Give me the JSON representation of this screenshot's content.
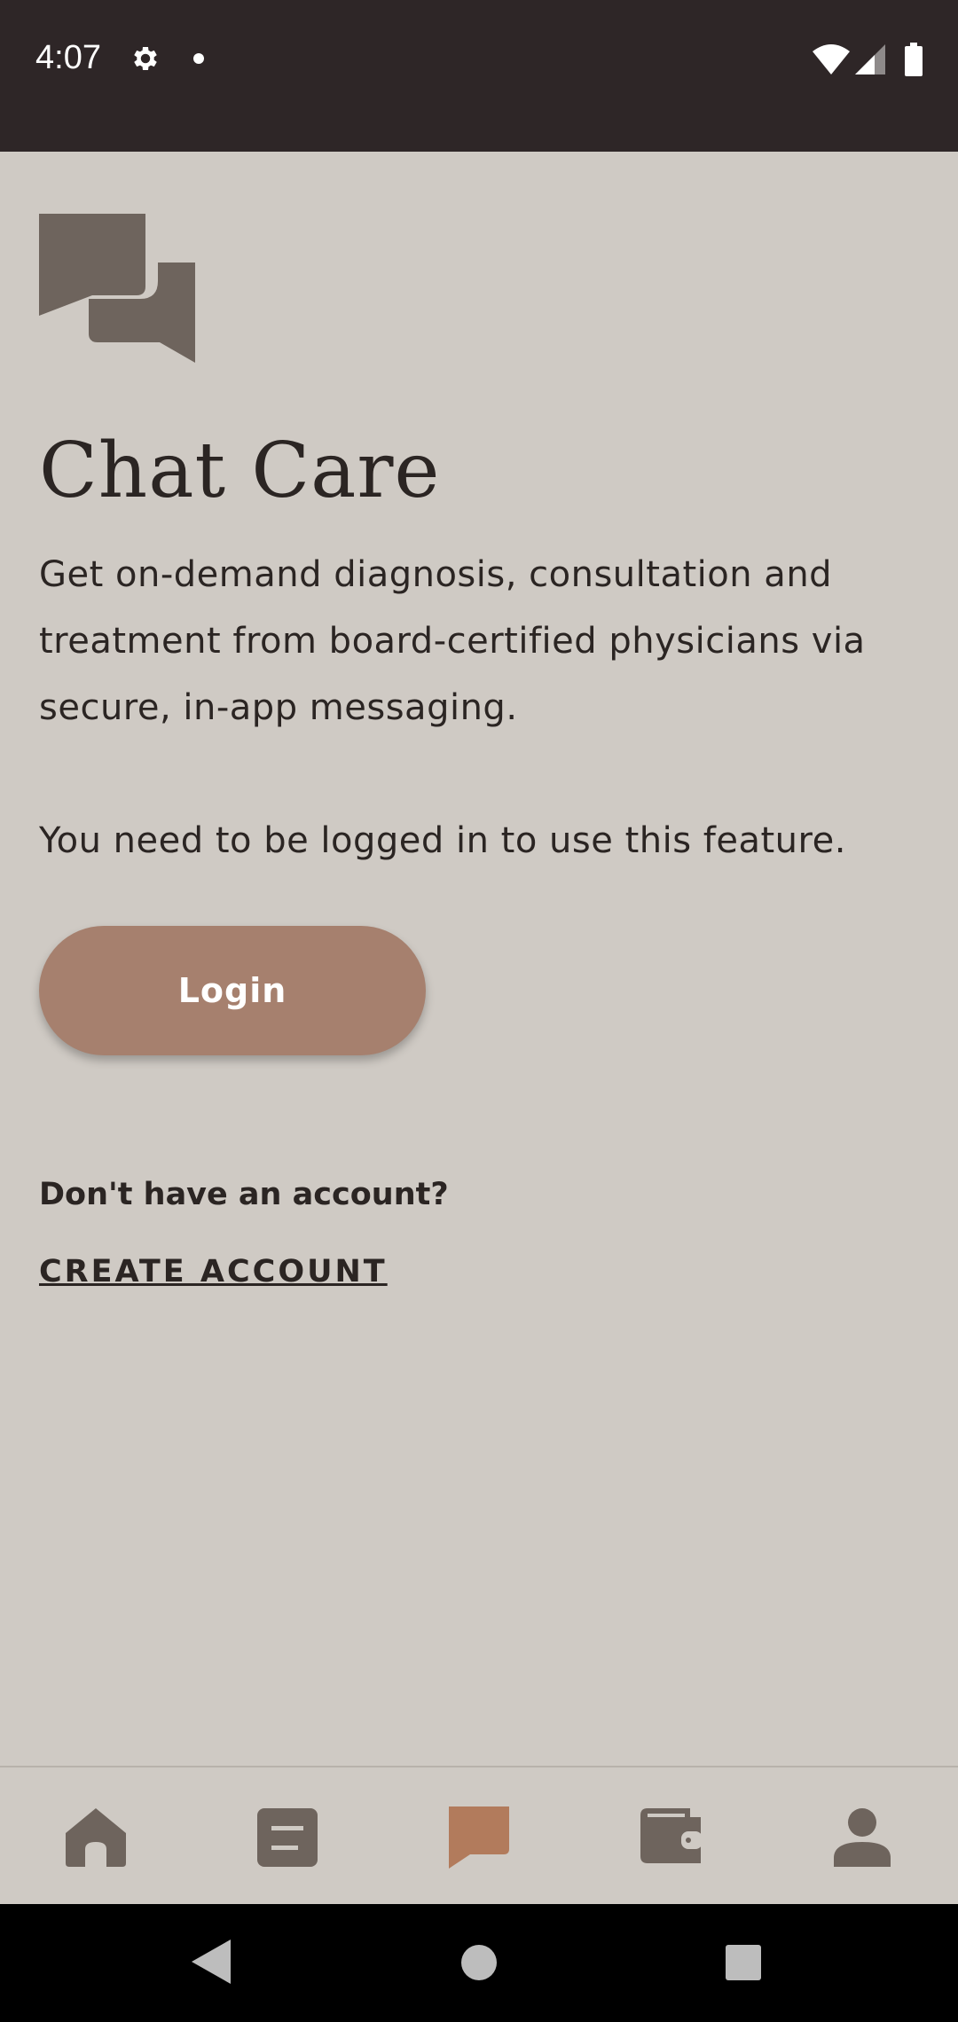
{
  "status_bar": {
    "time": "4:07",
    "icons": [
      "gear-icon",
      "notification-dot-icon",
      "wifi-icon",
      "signal-icon",
      "battery-icon"
    ]
  },
  "app": {
    "logo_icon": "chat-bubbles-icon",
    "title": "Chat Care",
    "description": "Get on-demand diagnosis, consultation and treatment from board-certified physicians via secure, in-app messaging.",
    "login_note": "You need to be logged in to use this feature.",
    "login_button_label": "Login",
    "no_account_text": "Don't have an account?",
    "create_account_label": "CREATE ACCOUNT"
  },
  "bottom_nav": {
    "items": [
      {
        "icon": "home-icon",
        "active": false
      },
      {
        "icon": "document-icon",
        "active": false
      },
      {
        "icon": "chat-icon",
        "active": true
      },
      {
        "icon": "wallet-icon",
        "active": false
      },
      {
        "icon": "profile-icon",
        "active": false
      }
    ]
  },
  "colors": {
    "background": "#cfcac4",
    "status_bar": "#2e2627",
    "accent": "#b27b5c",
    "button": "#a6806e",
    "icon": "#6e645d",
    "text": "#2b2523"
  }
}
